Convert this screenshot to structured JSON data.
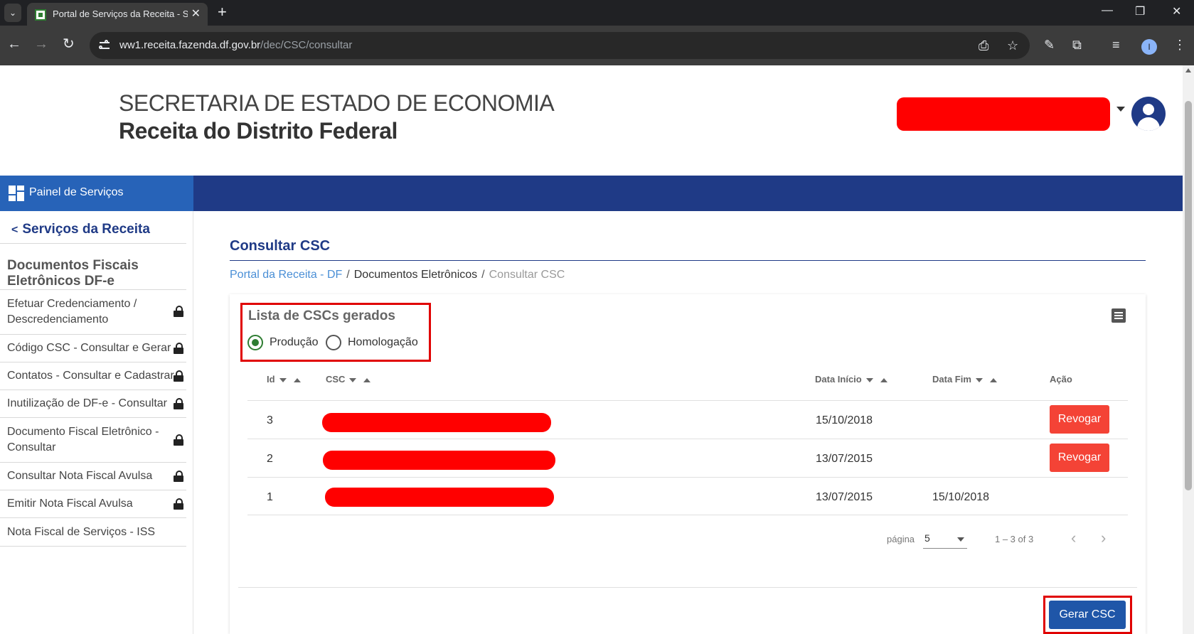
{
  "browser": {
    "tab_title": "Portal de Serviços da Receita - S",
    "url_host": "ww1.receita.fazenda.df.gov.br",
    "url_path": "/dec/CSC/consultar",
    "profile_initial": "I"
  },
  "header": {
    "org_line1": "SECRETARIA DE ESTADO DE ECONOMIA",
    "org_line2": "Receita do Distrito Federal"
  },
  "nav": {
    "panel_label": "Painel de Serviços"
  },
  "sidebar": {
    "back_label": "Serviços da Receita",
    "section_title": "Documentos Fiscais Eletrônicos DF-e",
    "items": [
      {
        "label": "Efetuar Credenciamento / Descredenciamento",
        "locked": true
      },
      {
        "label": "Código CSC - Consultar e Gerar",
        "locked": true
      },
      {
        "label": "Contatos - Consultar e Cadastrar",
        "locked": true
      },
      {
        "label": "Inutilização de DF-e - Consultar",
        "locked": true
      },
      {
        "label": "Documento Fiscal Eletrônico - Consultar",
        "locked": true
      },
      {
        "label": "Consultar Nota Fiscal Avulsa",
        "locked": true
      },
      {
        "label": "Emitir Nota Fiscal Avulsa",
        "locked": true
      },
      {
        "label": "Nota Fiscal de Serviços - ISS",
        "locked": false
      }
    ]
  },
  "main": {
    "title": "Consultar CSC",
    "breadcrumb": [
      "Portal da Receita - DF",
      "Documentos Eletrônicos",
      "Consultar CSC"
    ],
    "breadcrumb_sep": "/",
    "card_title": "Lista de CSCs gerados",
    "environment": {
      "options": [
        "Produção",
        "Homologação"
      ],
      "selected": "Produção"
    },
    "table": {
      "columns": [
        "Id",
        "CSC",
        "Data Início",
        "Data Fim",
        "Ação"
      ],
      "rows": [
        {
          "id": "3",
          "csc": "",
          "data_inicio": "15/10/2018",
          "data_fim": "",
          "action": "Revogar"
        },
        {
          "id": "2",
          "csc": "",
          "data_inicio": "13/07/2015",
          "data_fim": "",
          "action": "Revogar"
        },
        {
          "id": "1",
          "csc": "",
          "data_inicio": "13/07/2015",
          "data_fim": "15/10/2018",
          "action": ""
        }
      ]
    },
    "pagination": {
      "label": "página",
      "page_size": "5",
      "range": "1 – 3 of 3"
    },
    "generate_label": "Gerar CSC"
  },
  "colors": {
    "primary_dark": "#1f3a86",
    "panel_tab": "#2763b8",
    "revoke": "#f44336",
    "generate": "#1f56a8",
    "redaction": "#ff0000",
    "highlight": "#e00000"
  }
}
